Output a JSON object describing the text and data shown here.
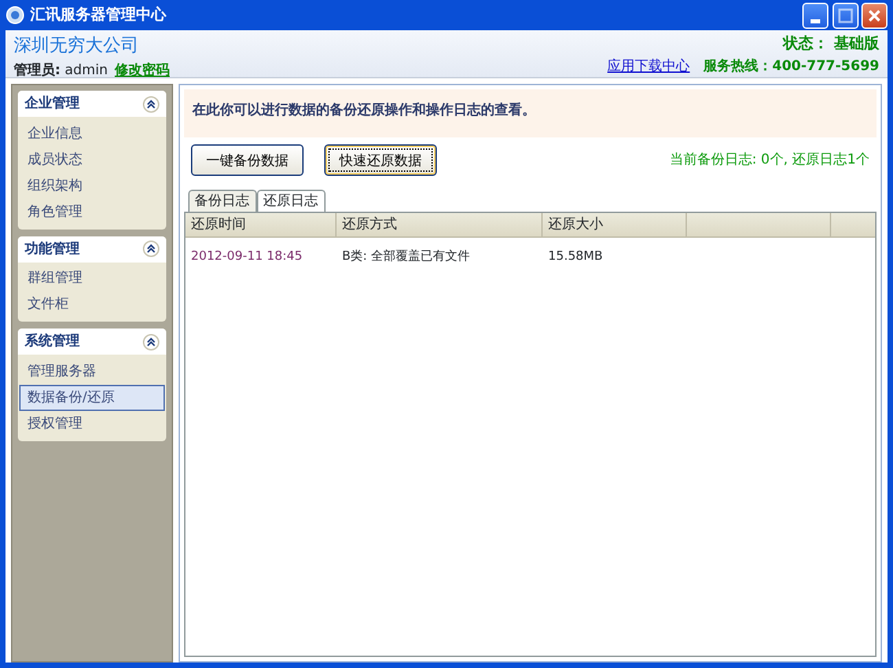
{
  "window": {
    "title": "汇讯服务器管理中心"
  },
  "header": {
    "company": "深圳无穷大公司",
    "admin": "**管理员:** admin",
    "change_password": "修改密码",
    "status": "状态： 基础版",
    "download_link": "应用下载中心",
    "hotline": "服务热线：400-777-5699"
  },
  "sidebar": {
    "groups": [
      {
        "title": "企业管理",
        "expanded": true,
        "items": [
          {
            "label": "企业信息",
            "selected": false
          },
          {
            "label": "成员状态",
            "selected": false
          },
          {
            "label": "组织架构",
            "selected": false
          },
          {
            "label": "角色管理",
            "selected": false
          }
        ]
      },
      {
        "title": "功能管理",
        "expanded": true,
        "items": [
          {
            "label": "群组管理",
            "selected": false
          },
          {
            "label": "文件柜",
            "selected": false
          }
        ]
      },
      {
        "title": "系统管理",
        "expanded": true,
        "items": [
          {
            "label": "管理服务器",
            "selected": false
          },
          {
            "label": "数据备份/还原",
            "selected": true
          },
          {
            "label": "授权管理",
            "selected": false
          }
        ]
      }
    ]
  },
  "main": {
    "intro": "在此你可以进行数据的备份还原操作和操作日志的查看。",
    "buttons": [
      {
        "label": "一键备份数据",
        "focused": false
      },
      {
        "label": "快速还原数据",
        "focused": true
      }
    ],
    "summary": "当前备份日志: 0个, 还原日志1个",
    "tabs": [
      {
        "label": "备份日志",
        "selected": false
      },
      {
        "label": "还原日志",
        "selected": true
      }
    ],
    "table": {
      "columns": [
        "还原时间",
        "还原方式",
        "还原大小"
      ],
      "rows": [
        [
          "2012-09-11 18:45",
          "B类: 全部覆盖已有文件",
          "15.58MB"
        ]
      ]
    }
  }
}
